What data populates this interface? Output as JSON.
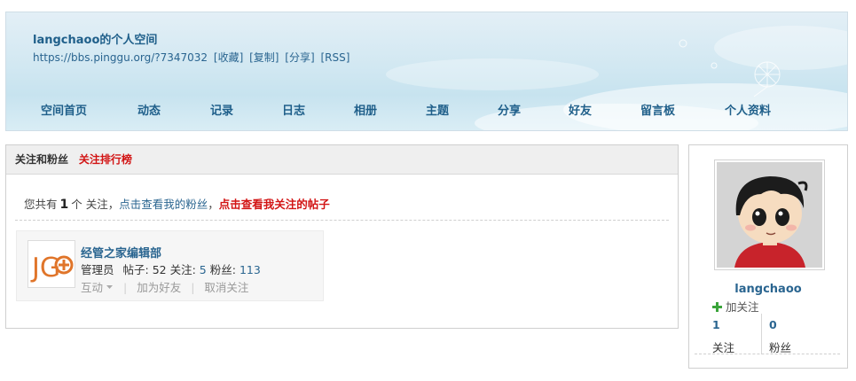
{
  "header": {
    "space_title": "langchaoo的个人空间",
    "url": "https://bbs.pinggu.org/?7347032",
    "url_actions": [
      "[收藏]",
      "[复制]",
      "[分享]",
      "[RSS]"
    ],
    "nav": [
      "空间首页",
      "动态",
      "记录",
      "日志",
      "相册",
      "主题",
      "分享",
      "好友",
      "留言板",
      "个人资料"
    ]
  },
  "panel": {
    "tab_active": "关注和粉丝",
    "tab_rank": "关注排行榜",
    "summary_prefix": "您共有",
    "summary_count": "1",
    "summary_unit": "个 关注，",
    "summary_fans_link": "点击查看我的粉丝",
    "summary_comma": "，",
    "summary_posts_link": "点击查看我关注的帖子"
  },
  "follow_card": {
    "logo_text": "JG",
    "name": "经管之家编辑部",
    "role": "管理员",
    "posts_label": "帖子:",
    "posts": "52",
    "following_label": "关注:",
    "following": "5",
    "fans_label": "粉丝:",
    "fans": "113",
    "action_interact": "互动",
    "action_add_friend": "加为好友",
    "action_unfollow": "取消关注"
  },
  "sidebar": {
    "username": "langchaoo",
    "follow_label": "加关注",
    "following_count": "1",
    "following_label": "关注",
    "fans_count": "0",
    "fans_label": "粉丝"
  },
  "colors": {
    "link_blue": "#2a6590",
    "accent_red": "#d21414",
    "plus_green": "#3aa43a",
    "logo_orange": "#e0752a"
  }
}
